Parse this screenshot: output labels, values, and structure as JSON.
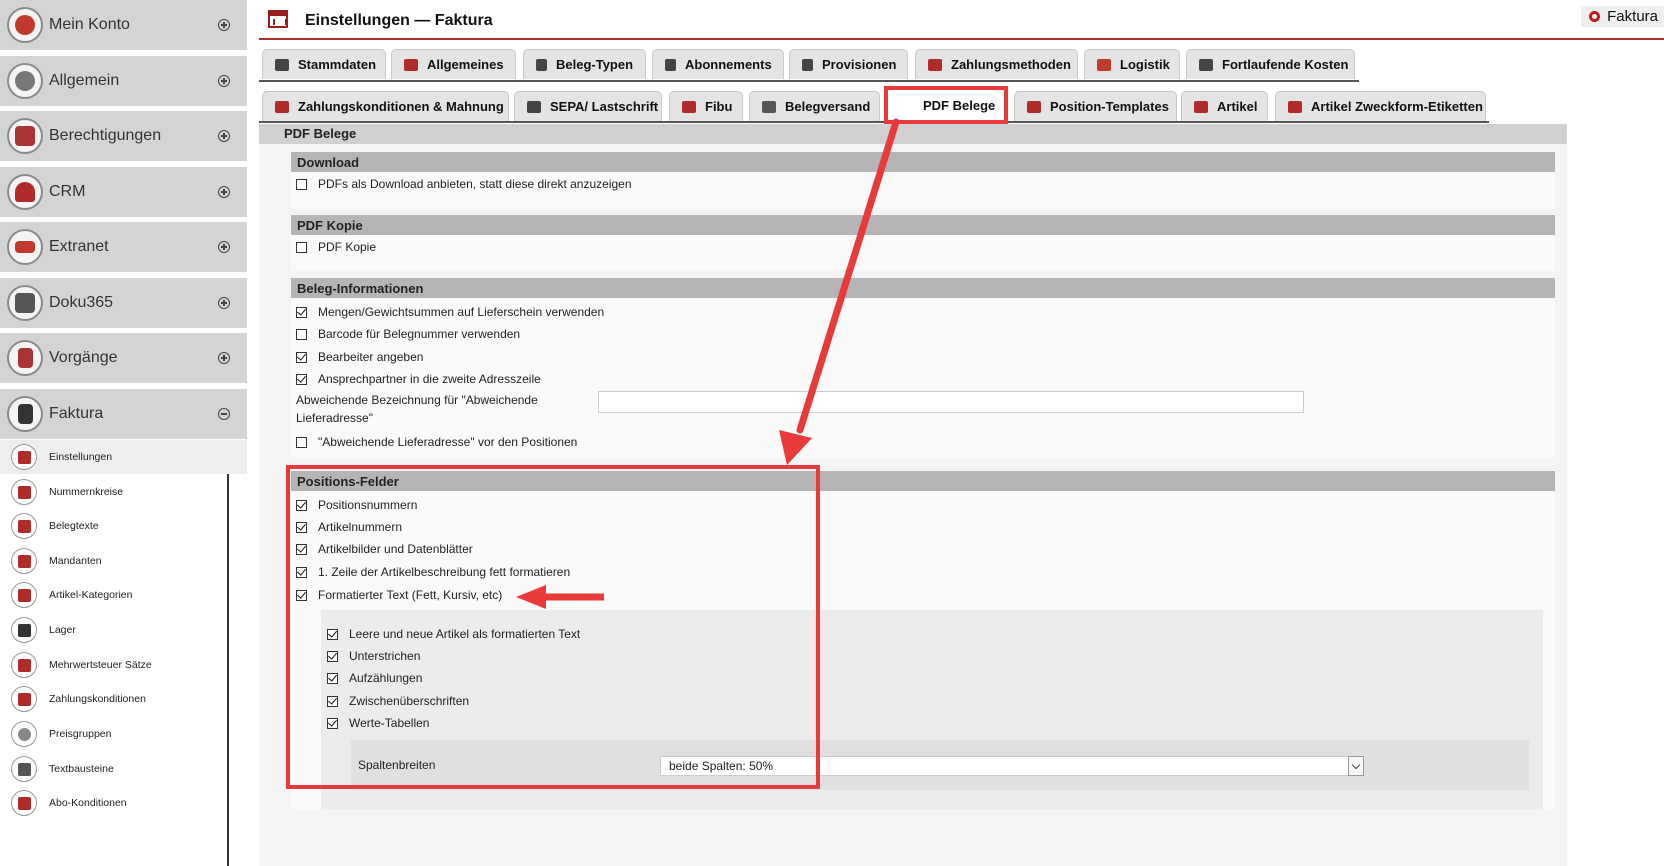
{
  "sidebar": {
    "modules": [
      {
        "label": "Mein Konto",
        "icon": "user-icon",
        "state": "collapsed"
      },
      {
        "label": "Allgemein",
        "icon": "disc-icon",
        "state": "collapsed"
      },
      {
        "label": "Berechtigungen",
        "icon": "books-icon",
        "state": "collapsed"
      },
      {
        "label": "CRM",
        "icon": "users-icon",
        "state": "collapsed"
      },
      {
        "label": "Extranet",
        "icon": "sitemap-icon",
        "state": "collapsed"
      },
      {
        "label": "Doku365",
        "icon": "browser-icon",
        "state": "collapsed"
      },
      {
        "label": "Vorgänge",
        "icon": "clipboard-icon",
        "state": "collapsed"
      },
      {
        "label": "Faktura",
        "icon": "document-icon",
        "state": "expanded"
      }
    ],
    "submenu": [
      {
        "label": "Einstellungen",
        "icon": "settings-table-icon",
        "active": true
      },
      {
        "label": "Nummernkreise",
        "icon": "table-icon"
      },
      {
        "label": "Belegtexte",
        "icon": "table-icon"
      },
      {
        "label": "Mandanten",
        "icon": "house-icon"
      },
      {
        "label": "Artikel-Kategorien",
        "icon": "category-icon"
      },
      {
        "label": "Lager",
        "icon": "warehouse-icon"
      },
      {
        "label": "Mehrwertsteuer Sätze",
        "icon": "tax-icon"
      },
      {
        "label": "Zahlungskonditionen",
        "icon": "payment-doc-icon"
      },
      {
        "label": "Preisgruppen",
        "icon": "eye-icon"
      },
      {
        "label": "Textbausteine",
        "icon": "text-icon"
      },
      {
        "label": "Abo-Konditionen",
        "icon": "subscription-icon"
      }
    ]
  },
  "header": {
    "title": "Einstellungen — Faktura",
    "badge": "Faktura"
  },
  "tabs": {
    "row1": [
      {
        "label": "Stammdaten",
        "icon": "flask-icon"
      },
      {
        "label": "Allgemeines",
        "icon": "gears-icon"
      },
      {
        "label": "Beleg-Typen",
        "icon": "document-icon"
      },
      {
        "label": "Abonnements",
        "icon": "document-icon"
      },
      {
        "label": "Provisionen",
        "icon": "document-icon"
      },
      {
        "label": "Zahlungsmethoden",
        "icon": "card-icon"
      },
      {
        "label": "Logistik",
        "icon": "truck-icon"
      },
      {
        "label": "Fortlaufende Kosten",
        "icon": "flask-icon"
      }
    ],
    "row2": [
      {
        "label": "Zahlungskonditionen & Mahnung",
        "icon": "card-icon"
      },
      {
        "label": "SEPA/ Lastschrift",
        "icon": "cone-icon"
      },
      {
        "label": "Fibu",
        "icon": "export-icon"
      },
      {
        "label": "Belegversand",
        "icon": "mail-icon"
      },
      {
        "label": "PDF Belege",
        "icon": "pdf-icon",
        "active": true
      },
      {
        "label": "Position-Templates",
        "icon": "bag-icon"
      },
      {
        "label": "Artikel",
        "icon": "bag-icon"
      },
      {
        "label": "Artikel Zweckform-Etiketten",
        "icon": "bag-icon"
      }
    ]
  },
  "content": {
    "subtitle": "PDF Belege",
    "download": {
      "title": "Download",
      "items": [
        {
          "label": "PDFs als Download anbieten, statt diese direkt anzuzeigen",
          "checked": false
        }
      ]
    },
    "pdf_kopie": {
      "title": "PDF Kopie",
      "items": [
        {
          "label": "PDF Kopie",
          "checked": false
        }
      ]
    },
    "beleg_info": {
      "title": "Beleg-Informationen",
      "items": [
        {
          "label": "Mengen/Gewichtsummen auf Lieferschein verwenden",
          "checked": true
        },
        {
          "label": "Barcode für Belegnummer verwenden",
          "checked": false
        },
        {
          "label": "Bearbeiter angeben",
          "checked": true
        },
        {
          "label": "Ansprechpartner in die zweite Adresszeile",
          "checked": true
        }
      ],
      "field_label": "Abweichende Bezeichnung für \"Abweichende Lieferadresse\"",
      "field_value": "",
      "last_item": {
        "label": "\"Abweichende Lieferadresse\" vor den Positionen",
        "checked": false
      }
    },
    "positions": {
      "title": "Positions-Felder",
      "items": [
        {
          "label": "Positionsnummern",
          "checked": true
        },
        {
          "label": "Artikelnummern",
          "checked": true
        },
        {
          "label": "Artikelbilder und Datenblätter",
          "checked": true
        },
        {
          "label": "1. Zeile der Artikelbeschreibung fett formatieren",
          "checked": true
        },
        {
          "label": "Formatierter Text (Fett, Kursiv, etc)",
          "checked": true
        }
      ],
      "sub_items": [
        {
          "label": "Leere und neue Artikel als formatierten Text",
          "checked": true
        },
        {
          "label": "Unterstrichen",
          "checked": true
        },
        {
          "label": "Aufzählungen",
          "checked": true
        },
        {
          "label": "Zwischenüberschriften",
          "checked": true
        },
        {
          "label": "Werte-Tabellen",
          "checked": true
        }
      ],
      "spalten_label": "Spaltenbreiten",
      "spalten_value": "beide Spalten: 50%"
    }
  },
  "colors": {
    "accent": "#b03030",
    "annotation_red": "#e83a3a",
    "sidebar_bg": "#d4d4d4"
  }
}
